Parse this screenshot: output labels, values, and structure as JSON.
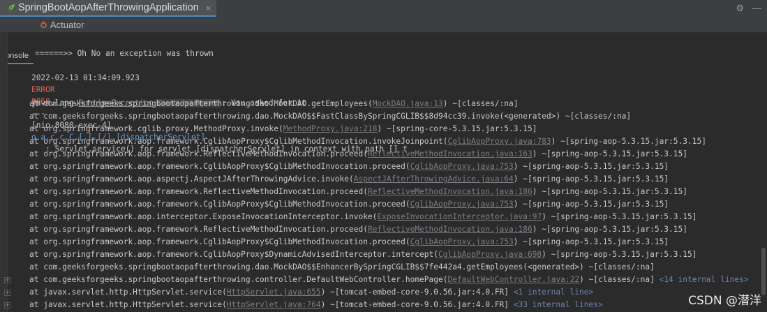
{
  "run_tab": {
    "title": "SpringBootAopAfterThrowingApplication",
    "close": "×"
  },
  "toolbar": {
    "settings_icon": "gear-icon",
    "hide_icon": "minus-icon",
    "settings_glyph": "⚙",
    "hide_glyph": "—"
  },
  "subtabs": {
    "console": "Console",
    "actuator": "Actuator"
  },
  "console": {
    "line_oh_no": "======>> Oh No an exception was thrown",
    "log": {
      "timestamp": "2022-02-13 01:34:09.923",
      "level": "ERROR",
      "pid": "9050",
      "sep": "---",
      "thread": "[nio-8080-exec-4]",
      "logger": "o.a.c.c.C.[.[.[/].[dispatcherServlet]",
      "message": ": Servlet.service() for servlet [dispatcherServlet] in context with path [] t"
    },
    "exception": {
      "prefix": "java.lang.",
      "class": "RuntimeException",
      "breakpoint": "Create breakpoint",
      "message": ": You asked for it"
    },
    "frames": [
      {
        "pre": "at com.geeksforgeeks.springbootaopafterthrowing.dao.MockDAO.getEmployees(",
        "link": "MockDAO.java:13",
        "post": ") ~[classes/:na]"
      },
      {
        "pre": "at com.geeksforgeeks.springbootaopafterthrowing.dao.MockDAO$$FastClassBySpringCGLIB$$8d94cc39.invoke(<generated>) ~[classes/:na]",
        "link": "",
        "post": ""
      },
      {
        "pre": "at org.springframework.cglib.proxy.MethodProxy.invoke(",
        "link": "MethodProxy.java:218",
        "post": ") ~[spring-core-5.3.15.jar:5.3.15]"
      },
      {
        "pre": "at org.springframework.aop.framework.CglibAopProxy$CglibMethodInvocation.invokeJoinpoint(",
        "link": "CglibAopProxy.java:783",
        "post": ") ~[spring-aop-5.3.15.jar:5.3.15]"
      },
      {
        "pre": "at org.springframework.aop.framework.ReflectiveMethodInvocation.proceed(",
        "link": "ReflectiveMethodInvocation.java:163",
        "post": ") ~[spring-aop-5.3.15.jar:5.3.15]"
      },
      {
        "pre": "at org.springframework.aop.framework.CglibAopProxy$CglibMethodInvocation.proceed(",
        "link": "CglibAopProxy.java:753",
        "post": ") ~[spring-aop-5.3.15.jar:5.3.15]"
      },
      {
        "pre": "at org.springframework.aop.aspectj.AspectJAfterThrowingAdvice.invoke(",
        "link": "AspectJAfterThrowingAdvice.java:64",
        "post": ") ~[spring-aop-5.3.15.jar:5.3.15]"
      },
      {
        "pre": "at org.springframework.aop.framework.ReflectiveMethodInvocation.proceed(",
        "link": "ReflectiveMethodInvocation.java:186",
        "post": ") ~[spring-aop-5.3.15.jar:5.3.15]"
      },
      {
        "pre": "at org.springframework.aop.framework.CglibAopProxy$CglibMethodInvocation.proceed(",
        "link": "CglibAopProxy.java:753",
        "post": ") ~[spring-aop-5.3.15.jar:5.3.15]"
      },
      {
        "pre": "at org.springframework.aop.interceptor.ExposeInvocationInterceptor.invoke(",
        "link": "ExposeInvocationInterceptor.java:97",
        "post": ") ~[spring-aop-5.3.15.jar:5.3.15]"
      },
      {
        "pre": "at org.springframework.aop.framework.ReflectiveMethodInvocation.proceed(",
        "link": "ReflectiveMethodInvocation.java:186",
        "post": ") ~[spring-aop-5.3.15.jar:5.3.15]"
      },
      {
        "pre": "at org.springframework.aop.framework.CglibAopProxy$CglibMethodInvocation.proceed(",
        "link": "CglibAopProxy.java:753",
        "post": ") ~[spring-aop-5.3.15.jar:5.3.15]"
      },
      {
        "pre": "at org.springframework.aop.framework.CglibAopProxy$DynamicAdvisedInterceptor.intercept(",
        "link": "CglibAopProxy.java:698",
        "post": ") ~[spring-aop-5.3.15.jar:5.3.15]"
      },
      {
        "pre": "at com.geeksforgeeks.springbootaopafterthrowing.dao.MockDAO$$EnhancerBySpringCGLIB$$7fe442a4.getEmployees(<generated>) ~[classes/:na]",
        "link": "",
        "post": ""
      },
      {
        "pre": "at com.geeksforgeeks.springbootaopafterthrowing.controller.DefaultWebController.homePage(",
        "link": "DefaultWebController.java:22",
        "post": ") ~[classes/:na] ",
        "internal": "<14 internal lines>"
      },
      {
        "pre": "at javax.servlet.http.HttpServlet.service(",
        "link": "HttpServlet.java:655",
        "post": ") ~[tomcat-embed-core-9.0.56.jar:4.0.FR] ",
        "internal": "<1 internal line>"
      },
      {
        "pre": "at javax.servlet.http.HttpServlet.service(",
        "link": "HttpServlet.java:764",
        "post": ") ~[tomcat-embed-core-9.0.56.jar:4.0.FR] ",
        "internal": "<33 internal lines>"
      }
    ]
  },
  "watermark": "CSDN @潜洋",
  "colors": {
    "background": "#2b2b2b",
    "error": "#d6695b",
    "logger": "#6a9bd1",
    "accent": "#4a88c7"
  }
}
